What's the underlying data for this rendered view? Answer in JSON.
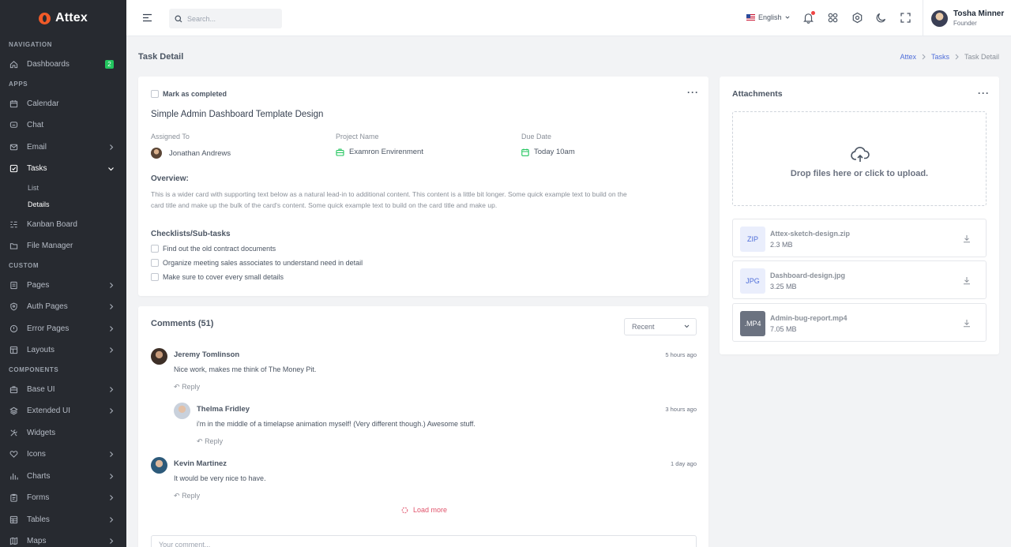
{
  "brand": {
    "name": "Attex"
  },
  "sidebar": {
    "sections": {
      "navigation": "NAVIGATION",
      "apps": "APPS",
      "custom": "CUSTOM",
      "components": "COMPONENTS"
    },
    "dashboards": {
      "label": "Dashboards",
      "badge": "2"
    },
    "calendar": "Calendar",
    "chat": "Chat",
    "email": "Email",
    "tasks": "Tasks",
    "tasks_list": "List",
    "tasks_details": "Details",
    "kanban": "Kanban Board",
    "file_manager": "File Manager",
    "pages": "Pages",
    "auth_pages": "Auth Pages",
    "error_pages": "Error Pages",
    "layouts": "Layouts",
    "base_ui": "Base UI",
    "extended_ui": "Extended UI",
    "widgets": "Widgets",
    "icons": "Icons",
    "charts": "Charts",
    "forms": "Forms",
    "tables": "Tables",
    "maps": "Maps"
  },
  "topbar": {
    "search_placeholder": "Search...",
    "language": "English",
    "user": {
      "name": "Tosha Minner",
      "role": "Founder"
    }
  },
  "page": {
    "title": "Task Detail",
    "breadcrumb": [
      "Attex",
      "Tasks",
      "Task Detail"
    ]
  },
  "task": {
    "mark_completed": "Mark as completed",
    "title": "Simple Admin Dashboard Template Design",
    "assigned_label": "Assigned To",
    "assigned_value": "Jonathan Andrews",
    "project_label": "Project Name",
    "project_value": "Examron Envirenment",
    "due_label": "Due Date",
    "due_value": "Today 10am",
    "overview_heading": "Overview:",
    "overview_text_1": "This is a wider card with supporting text below as a natural lead-in to additional content. This content is a little bit longer. Some quick example text to build on the",
    "overview_text_2": "card title and make up the bulk of the card's content. Some quick example text to build on the card title and make up.",
    "checklist_heading": "Checklists/Sub-tasks",
    "checklist": [
      "Find out the old contract documents",
      "Organize meeting sales associates to understand need in detail",
      "Make sure to cover every small details"
    ]
  },
  "comments": {
    "heading": "Comments (51)",
    "sort": "Recent",
    "items": [
      {
        "name": "Jeremy Tomlinson",
        "time": "5 hours ago",
        "text": "Nice work, makes me think of The Money Pit.",
        "reply": "Reply"
      },
      {
        "name": "Thelma Fridley",
        "time": "3 hours ago",
        "text": "i'm in the middle of a timelapse animation myself! (Very different though.) Awesome stuff.",
        "reply": "Reply"
      },
      {
        "name": "Kevin Martinez",
        "time": "1 day ago",
        "text": "It would be very nice to have.",
        "reply": "Reply"
      }
    ],
    "load_more": "Load more",
    "input_placeholder": "Your comment..."
  },
  "attachments": {
    "heading": "Attachments",
    "dropzone_text": "Drop files here or click to upload.",
    "files": [
      {
        "type": "ZIP",
        "name": "Attex-sketch-design.zip",
        "size": "2.3 MB"
      },
      {
        "type": "JPG",
        "name": "Dashboard-design.jpg",
        "size": "3.25 MB"
      },
      {
        "type": ".MP4",
        "name": "Admin-bug-report.mp4",
        "size": "7.05 MB"
      }
    ]
  },
  "colors": {
    "sidebar_bg": "#272a30",
    "accent": "#4f6ed9",
    "badge_green": "#22c55e",
    "load_more": "#e0536b",
    "logo": "#f05a28"
  }
}
